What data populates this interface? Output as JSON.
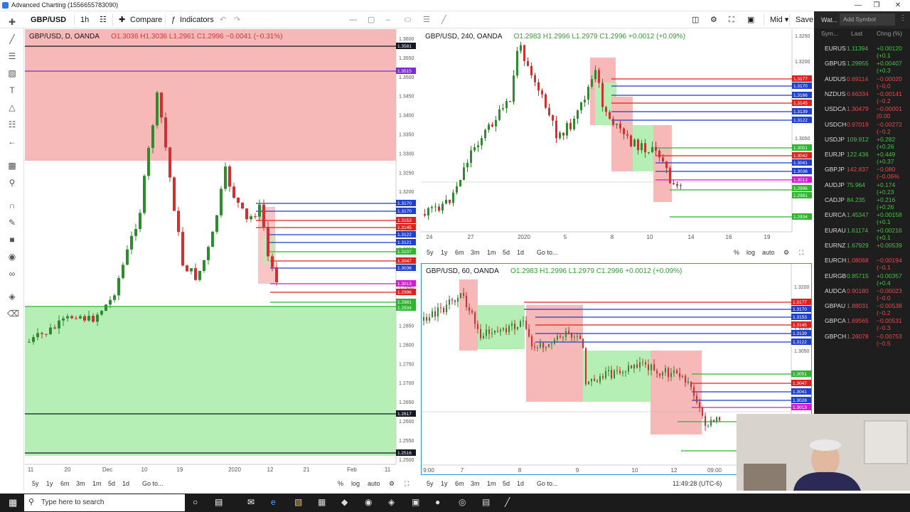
{
  "window": {
    "title": "Advanced Charting (1556655783090)",
    "controls": [
      "—",
      "❐",
      "✕"
    ]
  },
  "toolbar": {
    "symbol": "GBP/USD",
    "interval": "1h",
    "compare": "Compare",
    "indicators": "Indicators",
    "mid": "Mid ▾",
    "save": "Save"
  },
  "panes": {
    "daily": {
      "symbol": "GBP/USD, D, OANDA",
      "ohlc": "O1.3036  H1.3036  L1.2961  C1.2996  −0.0041 (−0.31%)",
      "price_ticks": [
        "1.3600",
        "1.3550",
        "1.3500",
        "1.3450",
        "1.3400",
        "1.3350",
        "1.3300",
        "1.3250",
        "1.3200",
        "1.3150",
        "1.3100",
        "1.3050",
        "1.3000",
        "1.2950",
        "1.2900",
        "1.2850",
        "1.2800",
        "1.2750",
        "1.2700",
        "1.2650",
        "1.2600",
        "1.2550",
        "1.2500"
      ],
      "x_labels": [
        "11",
        "20",
        "Dec",
        "10",
        "19",
        "2020",
        "12",
        "21",
        "Feb",
        "11"
      ],
      "tags": [
        {
          "v": "1.3581",
          "c": "#131722"
        },
        {
          "v": "1.3515",
          "c": "#7b2bd6"
        },
        {
          "v": "1.3170",
          "c": "#1f3fcf"
        },
        {
          "v": "1.3170",
          "c": "#1f3fcf"
        },
        {
          "v": "1.3153",
          "c": "#e02020"
        },
        {
          "v": "1.3145",
          "c": "#e02020"
        },
        {
          "v": "1.3122",
          "c": "#1f3fcf"
        },
        {
          "v": "1.3121",
          "c": "#1f3fcf"
        },
        {
          "v": "1.3107",
          "c": "#2fb52f"
        },
        {
          "v": "1.3047",
          "c": "#e02020"
        },
        {
          "v": "1.3036",
          "c": "#1f3fcf"
        },
        {
          "v": "1.3013",
          "c": "#d21bd2"
        },
        {
          "v": "1.2996",
          "c": "#e02020"
        },
        {
          "v": "1.2981",
          "c": "#2fb52f"
        },
        {
          "v": "1.2934",
          "c": "#2fb52f"
        },
        {
          "v": "1.2617",
          "c": "#131722"
        },
        {
          "v": "1.2516",
          "c": "#131722"
        }
      ]
    },
    "h4": {
      "symbol": "GBP/USD, 240, OANDA",
      "ohlc": "O1.2983  H1.2996  L1.2979  C1.2996  +0.0012 (+0.09%)",
      "price_ticks": [
        "1.3250",
        "1.3200",
        "1.3150",
        "1.3100",
        "1.3050",
        "1.3000",
        "1.2950",
        "1.2900"
      ],
      "x_labels": [
        "24",
        "27",
        "2020",
        "5",
        "8",
        "10",
        "14",
        "16",
        "19"
      ],
      "tags": [
        {
          "v": "1.3177",
          "c": "#e02020"
        },
        {
          "v": "1.3170",
          "c": "#1f3fcf"
        },
        {
          "v": "1.3166",
          "c": "#1f3fcf"
        },
        {
          "v": "1.3145",
          "c": "#e02020"
        },
        {
          "v": "1.3139",
          "c": "#1f3fcf"
        },
        {
          "v": "1.3122",
          "c": "#1f3fcf"
        },
        {
          "v": "1.3051",
          "c": "#2fb52f"
        },
        {
          "v": "1.3042",
          "c": "#e02020"
        },
        {
          "v": "1.3041",
          "c": "#1f3fcf"
        },
        {
          "v": "1.3036",
          "c": "#1f3fcf"
        },
        {
          "v": "1.3013",
          "c": "#d21bd2"
        },
        {
          "v": "1.2996",
          "c": "#2fb52f"
        },
        {
          "v": "1.2981",
          "c": "#2fb52f"
        },
        {
          "v": "1.2934",
          "c": "#2fb52f"
        }
      ]
    },
    "h1": {
      "symbol": "GBP/USD, 60, OANDA",
      "ohlc": "O1.2983  H1.2996  L1.2979  C1.2996  +0.0012 (+0.09%)",
      "price_ticks": [
        "1.3200",
        "1.3150",
        "1.3100",
        "1.3050",
        "1.3000"
      ],
      "x_labels": [
        "9:00",
        "7",
        "8",
        "9",
        "10",
        "12",
        "09:00"
      ],
      "time": "11:49:28 (UTC-6)",
      "tags": [
        {
          "v": "1.3177",
          "c": "#e02020"
        },
        {
          "v": "1.3170",
          "c": "#1f3fcf"
        },
        {
          "v": "1.3153",
          "c": "#1f3fcf"
        },
        {
          "v": "1.3145",
          "c": "#e02020"
        },
        {
          "v": "1.3139",
          "c": "#1f3fcf"
        },
        {
          "v": "1.3122",
          "c": "#1f3fcf"
        },
        {
          "v": "1.3051",
          "c": "#2fb52f"
        },
        {
          "v": "1.3047",
          "c": "#e02020"
        },
        {
          "v": "1.3041",
          "c": "#1f3fcf"
        },
        {
          "v": "1.3028",
          "c": "#1f3fcf"
        },
        {
          "v": "1.3013",
          "c": "#d21bd2"
        }
      ]
    }
  },
  "range_bar": {
    "items": [
      "5y",
      "1y",
      "6m",
      "3m",
      "1m",
      "5d",
      "1d",
      "Go to..."
    ],
    "pct": "%",
    "log": "log",
    "auto": "auto"
  },
  "watchlist": {
    "tab": "Wat...",
    "add": "Add Symbol",
    "cols": [
      "Sym...",
      "Last",
      "Chng (%)"
    ],
    "rows": [
      {
        "s": "EURUS",
        "l": "1.11394",
        "c": "+0.00120 (+0.1"
      },
      {
        "s": "GBPUS",
        "l": "1.29955",
        "c": "+0.00407 (+0.3"
      },
      {
        "s": "AUDUS",
        "l": "0.69114",
        "c": "−0.00020 (−0.0"
      },
      {
        "s": "NZDUS",
        "l": "0.66334",
        "c": "−0.00141 (−0.2"
      },
      {
        "s": "USDCA",
        "l": "1.30479",
        "c": "−0.00001 (0.00"
      },
      {
        "s": "USDCH",
        "l": "0.97019",
        "c": "−0.00272 (−0.2"
      },
      {
        "s": "USDJP",
        "l": "109.912",
        "c": "+0.282 (+0.26"
      },
      {
        "s": "EURJP",
        "l": "122.436",
        "c": "+0.449 (+0.37"
      },
      {
        "s": "GBPJP",
        "l": "142.837",
        "c": "−0.080 (−0.06%"
      },
      {
        "s": "AUDJP",
        "l": "75.964",
        "c": "+0.174 (+0.23"
      },
      {
        "s": "CADJP",
        "l": "84.235",
        "c": "+0.216 (+0.26"
      },
      {
        "s": "EURCA",
        "l": "1.45347",
        "c": "+0.00158 (+0.1"
      },
      {
        "s": "EURAU",
        "l": "1.61174",
        "c": "+0.00216 (+0.1"
      },
      {
        "s": "EURNZ",
        "l": "1.67929",
        "c": "+0.00539"
      },
      {
        "s": "EURCH",
        "l": "1.08068",
        "c": "−0.00194 (−0.1"
      },
      {
        "s": "EURGB",
        "l": "0.85715",
        "c": "+0.00357 (+0.4"
      },
      {
        "s": "AUDCA",
        "l": "0.90180",
        "c": "−0.00023 (−0.0"
      },
      {
        "s": "GBPAU",
        "l": "1.88031",
        "c": "−0.00538 (−0.2"
      },
      {
        "s": "GBPCA",
        "l": "1.69565",
        "c": "−0.00531 (−0.3"
      },
      {
        "s": "GBPCH",
        "l": "1.26078",
        "c": "−0.00753 (−0.5"
      }
    ]
  },
  "taskbar": {
    "search": "Type here to search"
  },
  "colors": {
    "bull": "#2e8b2e",
    "bear": "#d03030",
    "supply": "#f7b8b8",
    "demand": "#b6efb6",
    "up_text": "#3ec43e",
    "down_text": "#e24b4b"
  }
}
